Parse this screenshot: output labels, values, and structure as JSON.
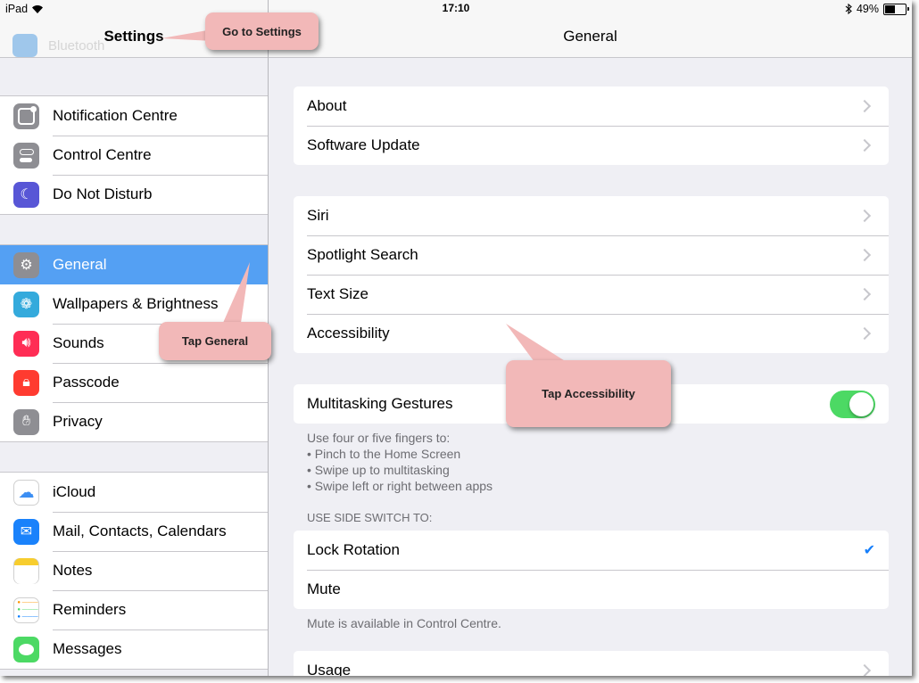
{
  "status_bar": {
    "device": "iPad",
    "network": "Wi-Fi",
    "time": "17:10",
    "battery": "49%",
    "battery_level": 0.49
  },
  "master": {
    "title": "Settings",
    "ghost_label": "Bluetooth",
    "groups": [
      [
        {
          "label": "Notification Centre",
          "icon": "notification-centre-icon",
          "color": "#8e8e93"
        },
        {
          "label": "Control Centre",
          "icon": "control-centre-icon",
          "color": "#8e8e93"
        },
        {
          "label": "Do Not Disturb",
          "icon": "moon-icon",
          "color": "#5856d6"
        }
      ],
      [
        {
          "label": "General",
          "icon": "gear-icon",
          "color": "#8e8e93",
          "selected": true
        },
        {
          "label": "Wallpapers & Brightness",
          "icon": "flower-icon",
          "color": "#34aadc"
        },
        {
          "label": "Sounds",
          "icon": "speaker-icon",
          "color": "#ff2d55"
        },
        {
          "label": "Passcode",
          "icon": "lock-icon",
          "color": "#ff3b30"
        },
        {
          "label": "Privacy",
          "icon": "hand-icon",
          "color": "#8e8e93"
        }
      ],
      [
        {
          "label": "iCloud",
          "icon": "cloud-icon",
          "color": "#ffffff"
        },
        {
          "label": "Mail, Contacts, Calendars",
          "icon": "mail-icon",
          "color": "#1a82fb"
        },
        {
          "label": "Notes",
          "icon": "notes-icon",
          "color": "#ffffff"
        },
        {
          "label": "Reminders",
          "icon": "reminders-icon",
          "color": "#ffffff"
        },
        {
          "label": "Messages",
          "icon": "messages-icon",
          "color": "#4cd964"
        }
      ]
    ]
  },
  "detail": {
    "title": "General",
    "group1": [
      "About",
      "Software Update"
    ],
    "group2": [
      "Siri",
      "Spotlight Search",
      "Text Size",
      "Accessibility"
    ],
    "multitasking_label": "Multitasking Gestures",
    "multitasking_on": true,
    "multitasking_notes": [
      "Use four or five fingers to:",
      "• Pinch to the Home Screen",
      "• Swipe up to multitasking",
      "• Swipe left or right between apps"
    ],
    "side_switch_header": "USE SIDE SWITCH TO:",
    "side_switch_options": [
      "Lock Rotation",
      "Mute"
    ],
    "side_switch_selected": "Lock Rotation",
    "mute_note": "Mute is available in Control Centre.",
    "usage_label": "Usage"
  },
  "callouts": {
    "settings": "Go to Settings",
    "general": "Tap General",
    "accessibility": "Tap Accessibility",
    "color": "#f2b8b8"
  }
}
